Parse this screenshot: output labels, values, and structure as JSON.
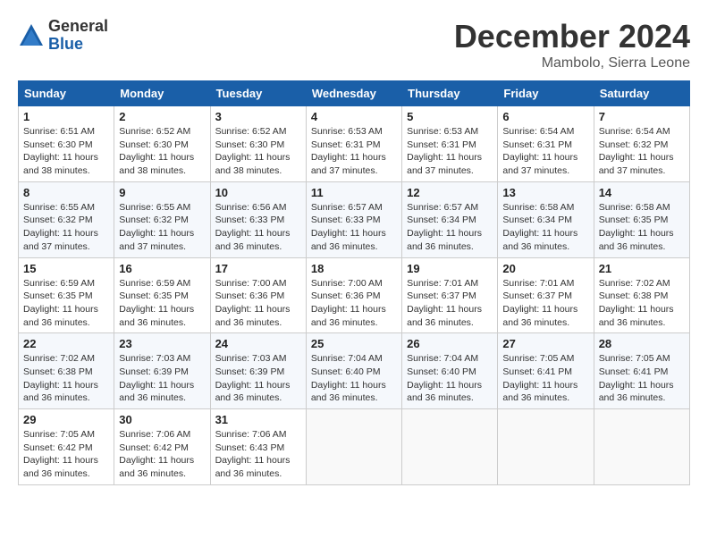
{
  "header": {
    "logo_general": "General",
    "logo_blue": "Blue",
    "month_title": "December 2024",
    "location": "Mambolo, Sierra Leone"
  },
  "days_of_week": [
    "Sunday",
    "Monday",
    "Tuesday",
    "Wednesday",
    "Thursday",
    "Friday",
    "Saturday"
  ],
  "weeks": [
    [
      {
        "day": "1",
        "info": "Sunrise: 6:51 AM\nSunset: 6:30 PM\nDaylight: 11 hours\nand 38 minutes."
      },
      {
        "day": "2",
        "info": "Sunrise: 6:52 AM\nSunset: 6:30 PM\nDaylight: 11 hours\nand 38 minutes."
      },
      {
        "day": "3",
        "info": "Sunrise: 6:52 AM\nSunset: 6:30 PM\nDaylight: 11 hours\nand 38 minutes."
      },
      {
        "day": "4",
        "info": "Sunrise: 6:53 AM\nSunset: 6:31 PM\nDaylight: 11 hours\nand 37 minutes."
      },
      {
        "day": "5",
        "info": "Sunrise: 6:53 AM\nSunset: 6:31 PM\nDaylight: 11 hours\nand 37 minutes."
      },
      {
        "day": "6",
        "info": "Sunrise: 6:54 AM\nSunset: 6:31 PM\nDaylight: 11 hours\nand 37 minutes."
      },
      {
        "day": "7",
        "info": "Sunrise: 6:54 AM\nSunset: 6:32 PM\nDaylight: 11 hours\nand 37 minutes."
      }
    ],
    [
      {
        "day": "8",
        "info": "Sunrise: 6:55 AM\nSunset: 6:32 PM\nDaylight: 11 hours\nand 37 minutes."
      },
      {
        "day": "9",
        "info": "Sunrise: 6:55 AM\nSunset: 6:32 PM\nDaylight: 11 hours\nand 37 minutes."
      },
      {
        "day": "10",
        "info": "Sunrise: 6:56 AM\nSunset: 6:33 PM\nDaylight: 11 hours\nand 36 minutes."
      },
      {
        "day": "11",
        "info": "Sunrise: 6:57 AM\nSunset: 6:33 PM\nDaylight: 11 hours\nand 36 minutes."
      },
      {
        "day": "12",
        "info": "Sunrise: 6:57 AM\nSunset: 6:34 PM\nDaylight: 11 hours\nand 36 minutes."
      },
      {
        "day": "13",
        "info": "Sunrise: 6:58 AM\nSunset: 6:34 PM\nDaylight: 11 hours\nand 36 minutes."
      },
      {
        "day": "14",
        "info": "Sunrise: 6:58 AM\nSunset: 6:35 PM\nDaylight: 11 hours\nand 36 minutes."
      }
    ],
    [
      {
        "day": "15",
        "info": "Sunrise: 6:59 AM\nSunset: 6:35 PM\nDaylight: 11 hours\nand 36 minutes."
      },
      {
        "day": "16",
        "info": "Sunrise: 6:59 AM\nSunset: 6:35 PM\nDaylight: 11 hours\nand 36 minutes."
      },
      {
        "day": "17",
        "info": "Sunrise: 7:00 AM\nSunset: 6:36 PM\nDaylight: 11 hours\nand 36 minutes."
      },
      {
        "day": "18",
        "info": "Sunrise: 7:00 AM\nSunset: 6:36 PM\nDaylight: 11 hours\nand 36 minutes."
      },
      {
        "day": "19",
        "info": "Sunrise: 7:01 AM\nSunset: 6:37 PM\nDaylight: 11 hours\nand 36 minutes."
      },
      {
        "day": "20",
        "info": "Sunrise: 7:01 AM\nSunset: 6:37 PM\nDaylight: 11 hours\nand 36 minutes."
      },
      {
        "day": "21",
        "info": "Sunrise: 7:02 AM\nSunset: 6:38 PM\nDaylight: 11 hours\nand 36 minutes."
      }
    ],
    [
      {
        "day": "22",
        "info": "Sunrise: 7:02 AM\nSunset: 6:38 PM\nDaylight: 11 hours\nand 36 minutes."
      },
      {
        "day": "23",
        "info": "Sunrise: 7:03 AM\nSunset: 6:39 PM\nDaylight: 11 hours\nand 36 minutes."
      },
      {
        "day": "24",
        "info": "Sunrise: 7:03 AM\nSunset: 6:39 PM\nDaylight: 11 hours\nand 36 minutes."
      },
      {
        "day": "25",
        "info": "Sunrise: 7:04 AM\nSunset: 6:40 PM\nDaylight: 11 hours\nand 36 minutes."
      },
      {
        "day": "26",
        "info": "Sunrise: 7:04 AM\nSunset: 6:40 PM\nDaylight: 11 hours\nand 36 minutes."
      },
      {
        "day": "27",
        "info": "Sunrise: 7:05 AM\nSunset: 6:41 PM\nDaylight: 11 hours\nand 36 minutes."
      },
      {
        "day": "28",
        "info": "Sunrise: 7:05 AM\nSunset: 6:41 PM\nDaylight: 11 hours\nand 36 minutes."
      }
    ],
    [
      {
        "day": "29",
        "info": "Sunrise: 7:05 AM\nSunset: 6:42 PM\nDaylight: 11 hours\nand 36 minutes."
      },
      {
        "day": "30",
        "info": "Sunrise: 7:06 AM\nSunset: 6:42 PM\nDaylight: 11 hours\nand 36 minutes."
      },
      {
        "day": "31",
        "info": "Sunrise: 7:06 AM\nSunset: 6:43 PM\nDaylight: 11 hours\nand 36 minutes."
      },
      {
        "day": "",
        "info": ""
      },
      {
        "day": "",
        "info": ""
      },
      {
        "day": "",
        "info": ""
      },
      {
        "day": "",
        "info": ""
      }
    ]
  ]
}
